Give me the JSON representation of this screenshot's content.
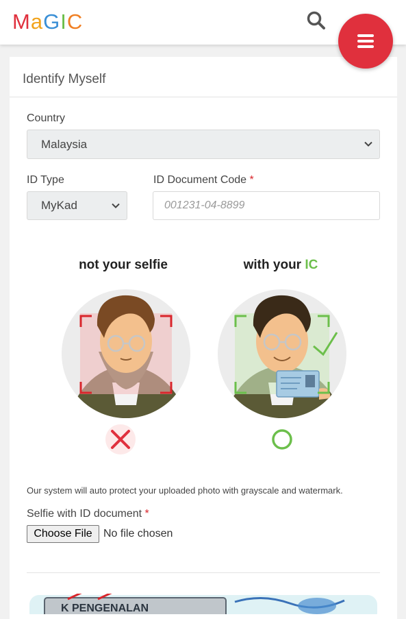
{
  "header": {
    "logo_text": "MaGIC",
    "search_icon": "search-icon",
    "menu_icon": "hamburger-icon",
    "menu_color": "#e0303d"
  },
  "form": {
    "title": "Identify Myself",
    "country": {
      "label": "Country",
      "value": "Malaysia"
    },
    "id_type": {
      "label": "ID Type",
      "value": "MyKad"
    },
    "id_code": {
      "label": "ID Document Code",
      "required_mark": "*",
      "placeholder": "001231-04-8899"
    },
    "illustration": {
      "left_caption": "not your selfie",
      "right_caption_prefix": "with your ",
      "right_caption_highlight": "IC",
      "left_status": "cross",
      "right_status": "circle",
      "highlight_color": "#6cbf4b",
      "cross_color": "#e0303d"
    },
    "note": "Our system will auto protect your uploaded photo with grayscale and watermark.",
    "selfie": {
      "label": "Selfie with ID document",
      "required_mark": "*",
      "button": "Choose File",
      "status": "No file chosen"
    },
    "banner_text": "K PENGENALAN"
  }
}
